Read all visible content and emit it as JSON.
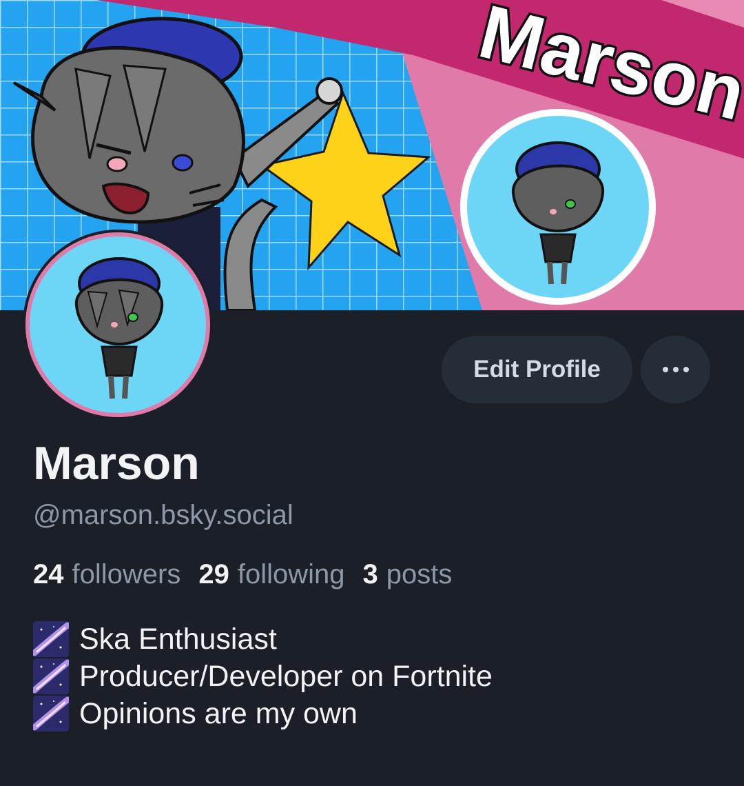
{
  "banner": {
    "text": "Marson"
  },
  "profile": {
    "display_name": "Marson",
    "handle": "@marson.bsky.social"
  },
  "actions": {
    "edit_label": "Edit Profile"
  },
  "stats": {
    "followers_count": "24",
    "followers_label": "followers",
    "following_count": "29",
    "following_label": "following",
    "posts_count": "3",
    "posts_label": "posts"
  },
  "bio": {
    "lines": [
      "Ska Enthusiast",
      "Producer/Developer on Fortnite",
      "Opinions are my own"
    ]
  },
  "colors": {
    "background": "#1a1f28",
    "button_bg": "#252d38",
    "name": "#f1f3f5",
    "muted": "#8d98a8",
    "banner_grid": "#27a5f0",
    "banner_stripe": "#c2286e",
    "banner_pink": "#e07aa8",
    "star": "#ffd21a"
  },
  "icons": {
    "bio_emoji": "milky-way-icon",
    "more": "ellipsis-icon"
  }
}
